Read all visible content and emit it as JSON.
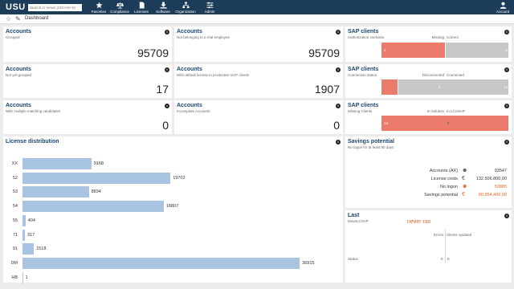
{
  "app": {
    "logo": "USU",
    "search_placeholder": "Search in Views (Ctrl+Alt+S)",
    "nav": [
      {
        "label": "Favorites",
        "icon": "star-icon"
      },
      {
        "label": "Compliance",
        "icon": "scales-icon"
      },
      {
        "label": "Licenses",
        "icon": "document-icon"
      },
      {
        "label": "Software",
        "icon": "download-icon"
      },
      {
        "label": "Organization",
        "icon": "org-chart-icon"
      },
      {
        "label": "Admin",
        "icon": "sliders-icon"
      }
    ],
    "account_label": "Account"
  },
  "breadcrumb": {
    "title": "Dashboard"
  },
  "cards": {
    "accounts_grouped": {
      "title": "Accounts",
      "subtitle": "Grouped",
      "value": "95709"
    },
    "accounts_not_employee": {
      "title": "Accounts",
      "subtitle": "Not belonging to a real employee",
      "value": "95709"
    },
    "accounts_not_grouped": {
      "title": "Accounts",
      "subtitle": "Not yet grouped",
      "value": "17"
    },
    "accounts_default_license": {
      "title": "Accounts",
      "subtitle": "With default license in productive SAP clients",
      "value": "1907"
    },
    "accounts_multiple": {
      "title": "Accounts",
      "subtitle": "With multiple matching candidates",
      "value": "0"
    },
    "accounts_incomplete": {
      "title": "Accounts",
      "subtitle": "Incomplete Accounts",
      "value": "0"
    }
  },
  "sap": [
    {
      "title": "SAP clients",
      "subtitle": "Authorization overview",
      "left_label": "Missing",
      "right_label": "Correct",
      "left_value": "2",
      "right_value": "2",
      "left_fraction": 0.5
    },
    {
      "title": "SAP clients",
      "subtitle": "Connection status",
      "left_label": "Disconnected",
      "right_label": "Connected",
      "left_value": "2",
      "right_value": "14",
      "left_fraction": 0.125
    },
    {
      "title": "SAP clients",
      "subtitle": "Missing Clients",
      "left_label": "In Solution",
      "right_label": "In LCASAP",
      "left_value": "14",
      "right_value": "0",
      "left_fraction": 1.0
    }
  ],
  "colors": {
    "missing": "#ec7b6b",
    "correct": "#c7c7c7",
    "bar": "#a8c4e2",
    "accent": "#e8642c",
    "header": "#1d3c5a"
  },
  "license_distribution": {
    "title": "License distribution",
    "chart_data": {
      "type": "bar",
      "orientation": "horizontal",
      "categories": [
        "XX",
        "52",
        "53",
        "54",
        "55",
        "71",
        "91",
        "DM",
        "HB"
      ],
      "values": [
        9168,
        19702,
        8834,
        18807,
        404,
        317,
        1518,
        36915,
        1
      ],
      "labels": [
        "9168",
        "19702",
        "8834",
        "18807",
        "404",
        "317",
        "1518",
        "36915",
        "1"
      ],
      "xlim": [
        0,
        40000
      ]
    }
  },
  "savings": {
    "title": "Savings potential",
    "subtitle": "No logon for at least 90 days",
    "rows": [
      {
        "label": "Accounts (AX)",
        "value": "93547",
        "icon": "person-icon",
        "highlight": false
      },
      {
        "label": "License costs",
        "value": "132.506.800,00",
        "icon": "euro-icon",
        "highlight": false
      },
      {
        "label": "No logon",
        "value": "50885",
        "icon": "person-icon",
        "highlight": true
      },
      {
        "label": "Savings potential",
        "value": "80.954.400,00",
        "icon": "euro-icon",
        "highlight": true
      }
    ]
  },
  "last": {
    "title": "Last",
    "subtitle": "MoveLCSAP",
    "never_ran": "never ran",
    "col_errors": "Errors",
    "col_clients": "Clients updated",
    "row_label": "Status",
    "errors_value": "0",
    "clients_value": "0"
  }
}
